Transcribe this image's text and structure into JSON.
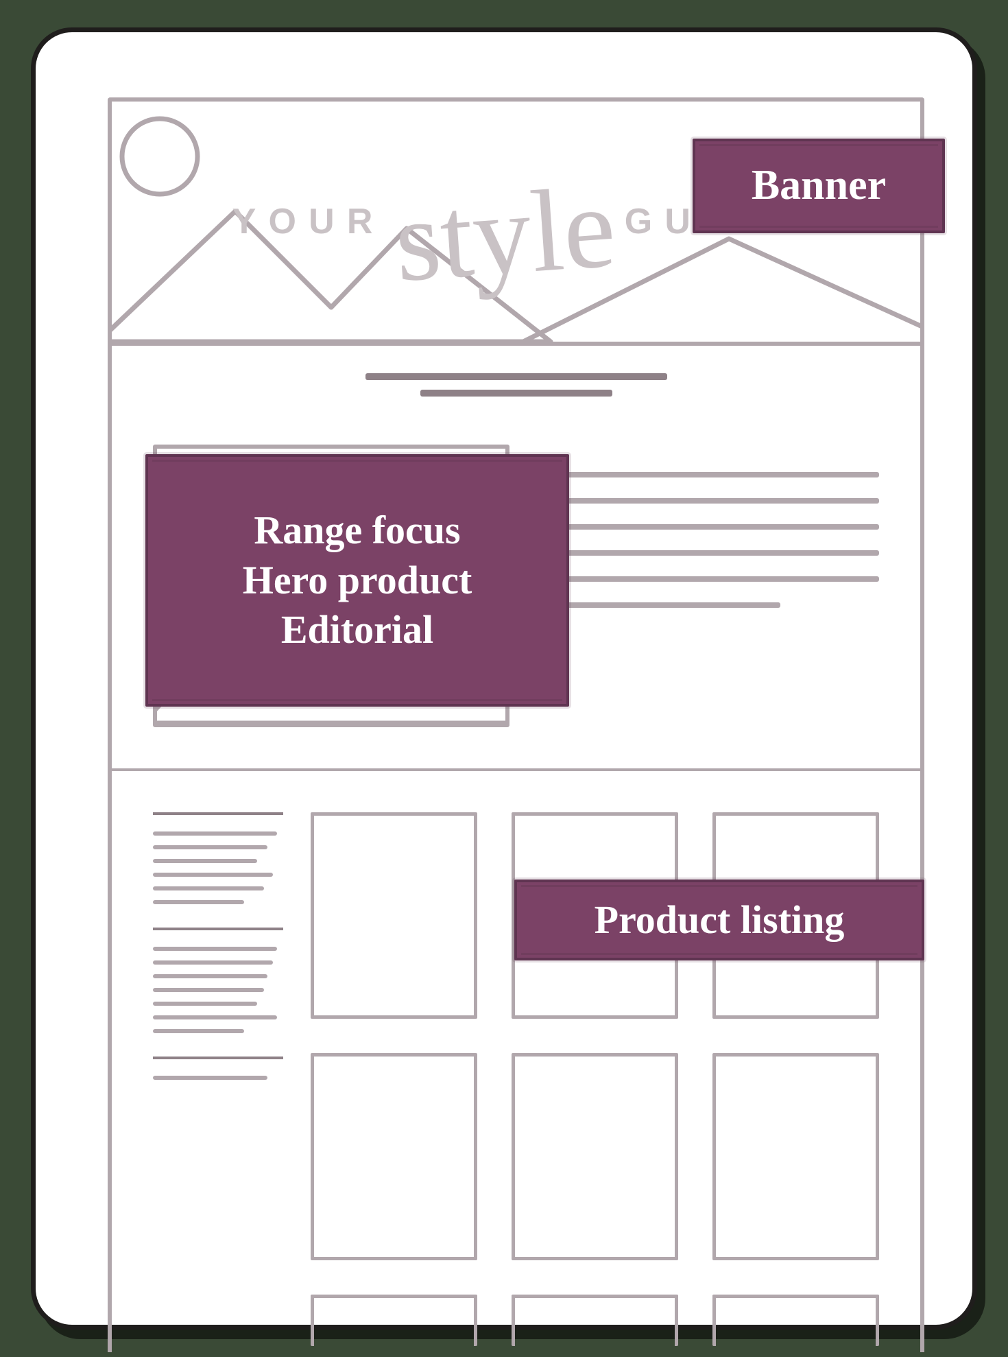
{
  "brand": {
    "word1": "YOUR",
    "word_script": "style",
    "word2": "GUIDE"
  },
  "callouts": {
    "banner": "Banner",
    "editorial_l1": "Range focus",
    "editorial_l2": "Hero product",
    "editorial_l3": "Editorial",
    "listing": "Product listing"
  },
  "colors": {
    "accent": "#7b4266",
    "stroke": "#b1a7ac"
  }
}
